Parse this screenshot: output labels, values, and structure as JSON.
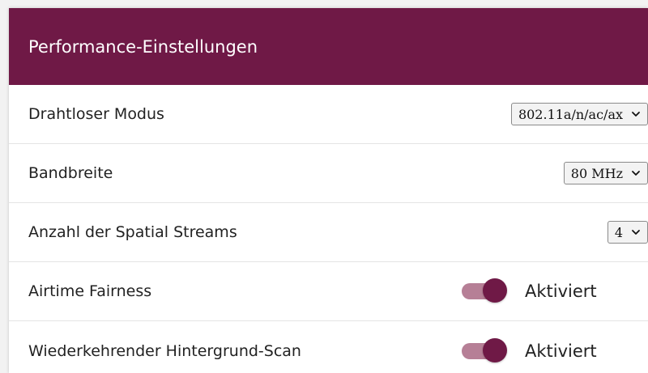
{
  "panel": {
    "title": "Performance-Einstellungen"
  },
  "rows": [
    {
      "label": "Drahtloser Modus",
      "control": "select",
      "value": "802.11a/n/ac/ax"
    },
    {
      "label": "Bandbreite",
      "control": "select",
      "value": "80 MHz"
    },
    {
      "label": "Anzahl der Spatial Streams",
      "control": "select",
      "value": "4"
    },
    {
      "label": "Airtime Fairness",
      "control": "toggle",
      "checked": true,
      "state_text": "Aktiviert"
    },
    {
      "label": "Wiederkehrender Hintergrund-Scan",
      "control": "toggle",
      "checked": true,
      "state_text": "Aktiviert"
    }
  ],
  "colors": {
    "header_bg": "#6f1946",
    "toggle_knob": "#6f1946",
    "toggle_track": "#b67f96"
  },
  "icons": {
    "select_arrow": "chevron-down-icon"
  }
}
